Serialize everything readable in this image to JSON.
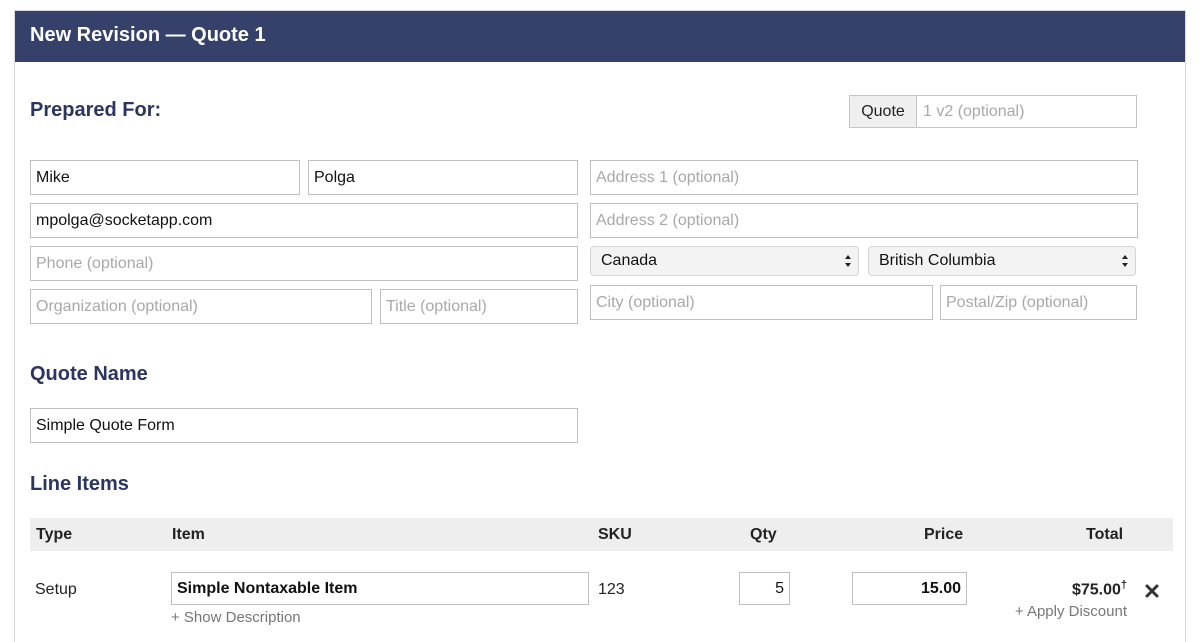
{
  "header": {
    "title": "New Revision — Quote 1"
  },
  "prepared_for": {
    "title": "Prepared For:",
    "quote_label": "Quote",
    "quote_number_placeholder": "1 v2 (optional)",
    "first_name": "Mike",
    "last_name": "Polga",
    "email": "mpolga@socketapp.com",
    "phone_placeholder": "Phone (optional)",
    "organization_placeholder": "Organization (optional)",
    "title_placeholder": "Title (optional)",
    "address1_placeholder": "Address 1 (optional)",
    "address2_placeholder": "Address 2 (optional)",
    "country": "Canada",
    "province": "British Columbia",
    "city_placeholder": "City (optional)",
    "postal_placeholder": "Postal/Zip (optional)"
  },
  "quote_name": {
    "title": "Quote Name",
    "value": "Simple Quote Form"
  },
  "line_items": {
    "title": "Line Items",
    "columns": {
      "type": "Type",
      "item": "Item",
      "sku": "SKU",
      "qty": "Qty",
      "price": "Price",
      "total": "Total"
    },
    "rows": [
      {
        "type": "Setup",
        "item": "Simple Nontaxable Item",
        "show_description": "+ Show Description",
        "sku": "123",
        "qty": "5",
        "price": "15.00",
        "total": "$75.00",
        "total_mark": "†",
        "apply_discount": "+ Apply Discount"
      }
    ]
  },
  "icons": {
    "remove": "close-icon",
    "select_arrows": "chevron-updown-icon"
  },
  "colors": {
    "header_bg": "#35406b",
    "section_title": "#2b3560",
    "table_header_bg": "#eeeeee"
  }
}
